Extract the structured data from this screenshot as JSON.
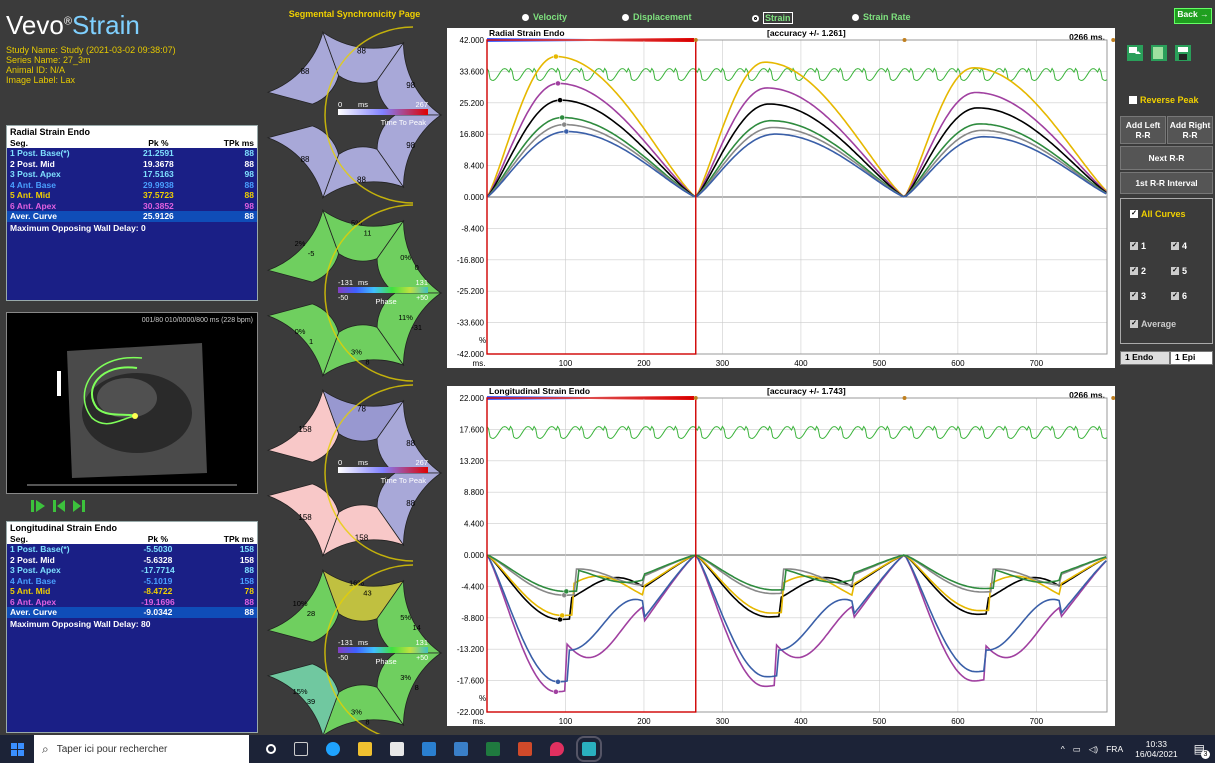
{
  "app": {
    "logo_main": "Vevo",
    "logo_reg": "®",
    "logo_sub": "Strain",
    "page_title": "Segmental Synchronicity Page",
    "back_label": "Back →"
  },
  "info": {
    "study": "Study Name: Study (2021-03-02 09:38:07)",
    "series": "Series Name: 27_3m",
    "animal": "Animal ID: N/A",
    "label": "Image Label: Lax"
  },
  "modes": [
    {
      "label": "Velocity",
      "selected": false
    },
    {
      "label": "Displacement",
      "selected": false
    },
    {
      "label": "Strain",
      "selected": true
    },
    {
      "label": "Strain Rate",
      "selected": false
    }
  ],
  "radial_table": {
    "title": "Radial Strain Endo",
    "col_seg": "Seg.",
    "col_pk": "Pk %",
    "col_tpk": "TPk ms",
    "rows": [
      {
        "seg": "1 Post. Base(*)",
        "pk": "21.2591",
        "tpk": "88",
        "color": "#7fe0ff"
      },
      {
        "seg": "2 Post. Mid",
        "pk": "19.3678",
        "tpk": "88",
        "color": "#ffffff"
      },
      {
        "seg": "3 Post. Apex",
        "pk": "17.5163",
        "tpk": "98",
        "color": "#7fe0ff"
      },
      {
        "seg": "4 Ant. Base",
        "pk": "29.9938",
        "tpk": "88",
        "color": "#4aa0ff"
      },
      {
        "seg": "5 Ant. Mid",
        "pk": "37.5723",
        "tpk": "88",
        "color": "#f0d000"
      },
      {
        "seg": "6 Ant. Apex",
        "pk": "30.3852",
        "tpk": "98",
        "color": "#e060e0"
      }
    ],
    "avg": {
      "seg": "Aver. Curve",
      "pk": "25.9126",
      "tpk": "88"
    },
    "foot": "Maximum Opposing Wall Delay: 0"
  },
  "long_table": {
    "title": "Longitudinal Strain Endo",
    "col_seg": "Seg.",
    "col_pk": "Pk %",
    "col_tpk": "TPk ms",
    "rows": [
      {
        "seg": "1 Post. Base(*)",
        "pk": "-5.5030",
        "tpk": "158",
        "color": "#7fe0ff"
      },
      {
        "seg": "2 Post. Mid",
        "pk": "-5.6328",
        "tpk": "158",
        "color": "#ffffff"
      },
      {
        "seg": "3 Post. Apex",
        "pk": "-17.7714",
        "tpk": "88",
        "color": "#7fe0ff"
      },
      {
        "seg": "4 Ant. Base",
        "pk": "-5.1019",
        "tpk": "158",
        "color": "#4aa0ff"
      },
      {
        "seg": "5 Ant. Mid",
        "pk": "-8.4722",
        "tpk": "78",
        "color": "#f0d000"
      },
      {
        "seg": "6 Ant. Apex",
        "pk": "-19.1696",
        "tpk": "88",
        "color": "#e060e0"
      }
    ],
    "avg": {
      "seg": "Aver. Curve",
      "pk": "-9.0342",
      "tpk": "88"
    },
    "foot": "Maximum Opposing Wall Delay: 80"
  },
  "us_caption": "001/80  010/0000/800 ms (228 bpm)",
  "rings": {
    "ttp1": {
      "values": [
        "88",
        "88",
        "98",
        "98",
        "88",
        "88"
      ],
      "scale_min": "0",
      "scale_unit": "ms",
      "scale_max": "267",
      "label": "Time To Peak"
    },
    "ph1": {
      "pct": [
        "2%",
        "5%",
        "0%",
        "11%",
        "3%",
        "0%"
      ],
      "vals": [
        "-5",
        "11",
        "0",
        "-31",
        "8",
        "1"
      ],
      "scale_min": "-131",
      "scale_unit": "ms",
      "scale_max": "131",
      "sub_min": "-50",
      "sub_max": "+50",
      "label": "Phase"
    },
    "ttp2": {
      "values": [
        "158",
        "78",
        "88",
        "88",
        "158",
        "158"
      ],
      "scale_min": "0",
      "scale_unit": "ms",
      "scale_max": "267",
      "label": "Time To Peak"
    },
    "ph2": {
      "pct": [
        "10%",
        "16%",
        "5%",
        "3%",
        "3%",
        "15%"
      ],
      "vals": [
        "28",
        "43",
        "14",
        "8",
        "8",
        "39"
      ],
      "scale_min": "-131",
      "scale_unit": "ms",
      "scale_max": "131",
      "sub_min": "-50",
      "sub_max": "+50",
      "label": "Phase"
    }
  },
  "radial_chart": {
    "title": "Radial Strain Endo",
    "accuracy": "[accuracy +/- 1.261]",
    "time": "0266 ms.",
    "unit": "%",
    "xunit": "ms.",
    "yticks": [
      "42.000",
      "33.600",
      "25.200",
      "16.800",
      "8.400",
      "0.000",
      "-8.400",
      "-16.800",
      "-25.200",
      "-33.600",
      "-42.000"
    ],
    "xticks": [
      "100",
      "200",
      "300",
      "400",
      "500",
      "600",
      "700"
    ]
  },
  "long_chart": {
    "title": "Longitudinal Strain Endo",
    "accuracy": "[accuracy +/- 1.743]",
    "time": "0266 ms.",
    "unit": "%",
    "xunit": "ms.",
    "yticks": [
      "22.000",
      "17.600",
      "13.200",
      "8.800",
      "4.400",
      "0.000",
      "-4.400",
      "-8.800",
      "-13.200",
      "-17.600",
      "-22.000"
    ],
    "xticks": [
      "100",
      "200",
      "300",
      "400",
      "500",
      "600",
      "700"
    ]
  },
  "chart_data": [
    {
      "type": "line",
      "title": "Radial Strain Endo",
      "xlabel": "ms.",
      "ylabel": "%",
      "xlim": [
        0,
        790
      ],
      "ylim": [
        -42,
        42
      ],
      "cycle_ms": 266,
      "series": [
        {
          "values_peak": 37.57,
          "color": "#e6b800"
        },
        {
          "values_peak": 30.39,
          "color": "#a040a0"
        },
        {
          "values_peak": 25.91,
          "color": "#000000"
        },
        {
          "values_peak": 21.26,
          "color": "#2e8b3e"
        },
        {
          "values_peak": 19.37,
          "color": "#888888"
        },
        {
          "values_peak": 17.52,
          "color": "#3a5fa8"
        }
      ]
    },
    {
      "type": "line",
      "title": "Longitudinal Strain Endo",
      "xlabel": "ms.",
      "ylabel": "%",
      "xlim": [
        0,
        790
      ],
      "ylim": [
        -22,
        22
      ],
      "cycle_ms": 266,
      "series": [
        {
          "values_peak": -19.17,
          "color": "#a040a0"
        },
        {
          "values_peak": -17.77,
          "color": "#3a5fa8"
        },
        {
          "values_peak": -9.03,
          "color": "#000000"
        },
        {
          "values_peak": -8.47,
          "color": "#e6b800"
        },
        {
          "values_peak": -5.63,
          "color": "#888888"
        },
        {
          "values_peak": -5.1,
          "color": "#2e8b3e"
        }
      ]
    }
  ],
  "right": {
    "reverse_peak": "Reverse Peak",
    "add_left": "Add Left R-R",
    "add_right": "Add Right R-R",
    "next_rr": "Next R-R",
    "first_rr": "1st R-R Interval",
    "all_curves": "All Curves",
    "c1": "1",
    "c2": "2",
    "c3": "3",
    "c4": "4",
    "c5": "5",
    "c6": "6",
    "average": "Average",
    "tab_endo": "1 Endo",
    "tab_epi": "1 Epi"
  },
  "taskbar": {
    "search": "Taper ici pour rechercher",
    "lang": "FRA",
    "time": "10:33",
    "date": "16/04/2021",
    "notif": "3"
  }
}
